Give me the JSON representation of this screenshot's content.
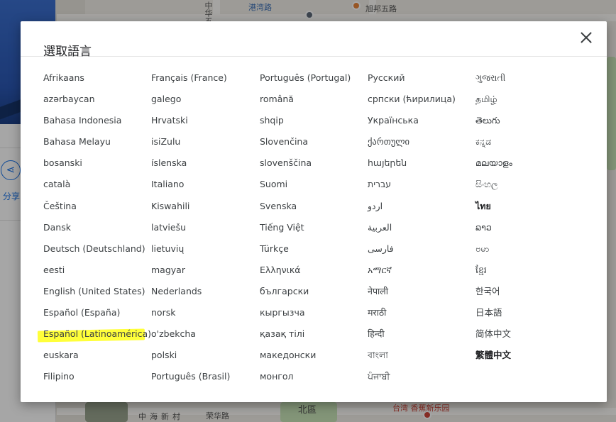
{
  "map": {
    "labels": [
      "中华五路",
      "港湾路",
      "旭邦五路",
      "荣华路",
      "中海新村",
      "台湾 香蕉新乐园",
      "北區"
    ],
    "side_panel": {
      "share_label": "分享"
    }
  },
  "dialog": {
    "title": "選取語言",
    "close_label": "✕",
    "selected_language": "English (United States)",
    "columns": [
      [
        "Afrikaans",
        "azərbaycan",
        "Bahasa Indonesia",
        "Bahasa Melayu",
        "bosanski",
        "català",
        "Čeština",
        "Dansk",
        "Deutsch (Deutschland)",
        "eesti",
        "English (United States)",
        "Español (España)",
        "Español (Latinoamérica)",
        "euskara",
        "Filipino"
      ],
      [
        "Français (France)",
        "galego",
        "Hrvatski",
        "isiZulu",
        "íslenska",
        "Italiano",
        "Kiswahili",
        "latviešu",
        "lietuvių",
        "magyar",
        "Nederlands",
        "norsk",
        "o'zbekcha",
        "polski",
        "Português (Brasil)"
      ],
      [
        "Português (Portugal)",
        "română",
        "shqip",
        "Slovenčina",
        "slovenščina",
        "Suomi",
        "Svenska",
        "Tiếng Việt",
        "Türkçe",
        "Ελληνικά",
        "български",
        "кыргызча",
        "қазақ тілі",
        "македонски",
        "монгол"
      ],
      [
        "Русский",
        "српски (ћирилица)",
        "Українська",
        "ქართული",
        "հայերեն",
        "עברית",
        "اردو",
        "العربية",
        "فارسی",
        "አማርኛ",
        "नेपाली",
        "मराठी",
        "हिन्दी",
        "বাংলা",
        "ਪੰਜਾਬੀ"
      ],
      [
        "ગુજરાતી",
        "தமிழ்",
        "తెలుగు",
        "ಕನ್ನಡ",
        "മലയാളം",
        "සිංහල",
        "ไทย",
        "ລາວ",
        "ဗမာ",
        "ខ្មែរ",
        "한국어",
        "日本語",
        "简体中文",
        "繁體中文"
      ]
    ],
    "bold_items": [
      "ไทย",
      "繁體中文"
    ]
  }
}
